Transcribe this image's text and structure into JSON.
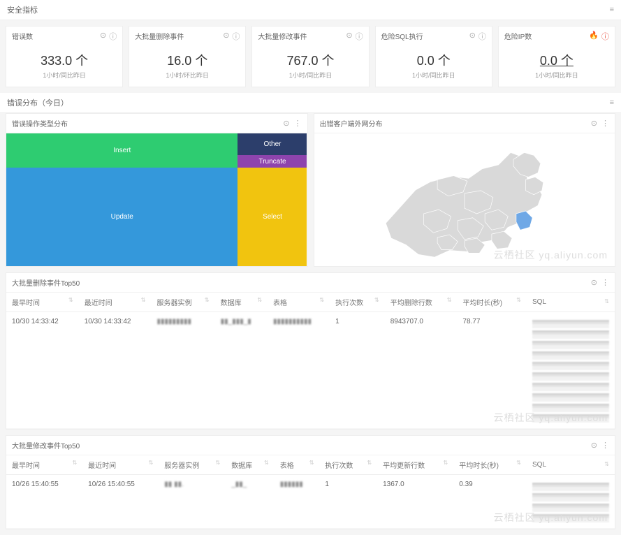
{
  "sections": {
    "security_metrics": "安全指标",
    "error_distribution": "错误分布（今日）"
  },
  "kpis": [
    {
      "title": "错误数",
      "value": "333.0 个",
      "sub": "1小时/同比昨日",
      "danger": false
    },
    {
      "title": "大批量删除事件",
      "value": "16.0 个",
      "sub": "1小时/环比昨日",
      "danger": false
    },
    {
      "title": "大批量修改事件",
      "value": "767.0 个",
      "sub": "1小时/同比昨日",
      "danger": false
    },
    {
      "title": "危险SQL执行",
      "value": "0.0 个",
      "sub": "1小时/同比昨日",
      "danger": false
    },
    {
      "title": "危险IP数",
      "value": "0.0 个",
      "sub": "1小时/同比昨日",
      "danger": true,
      "underline": true
    }
  ],
  "treemap": {
    "title": "错误操作类型分布",
    "cells": {
      "insert": "Insert",
      "update": "Update",
      "select": "Select",
      "other": "Other",
      "truncate": "Truncate"
    }
  },
  "mapcard": {
    "title": "出错客户端外网分布"
  },
  "watermark": "云栖社区 yq.aliyun.com",
  "table1": {
    "title": "大批量删除事件Top50",
    "cols": [
      "最早时间",
      "最近时间",
      "服务器实例",
      "数据库",
      "表格",
      "执行次数",
      "平均删除行数",
      "平均时长(秒)",
      "SQL"
    ],
    "row": {
      "t0": "10/30 14:33:42",
      "t1": "10/30 14:33:42",
      "exec": "1",
      "rows": "8943707.0",
      "dur": "78.77"
    }
  },
  "table2": {
    "title": "大批量修改事件Top50",
    "cols": [
      "最早时间",
      "最近时间",
      "服务器实例",
      "数据库",
      "表格",
      "执行次数",
      "平均更新行数",
      "平均时长(秒)",
      "SQL"
    ],
    "row": {
      "t0": "10/26 15:40:55",
      "t1": "10/26 15:40:55",
      "exec": "1",
      "rows": "1367.0",
      "dur": "0.39"
    }
  },
  "chart_data": {
    "type": "treemap",
    "title": "错误操作类型分布",
    "series": [
      {
        "name": "Update",
        "value": 57
      },
      {
        "name": "Insert",
        "value": 20
      },
      {
        "name": "Select",
        "value": 17
      },
      {
        "name": "Other",
        "value": 4
      },
      {
        "name": "Truncate",
        "value": 2
      }
    ],
    "note": "values are approximate area percentages read from the treemap"
  }
}
